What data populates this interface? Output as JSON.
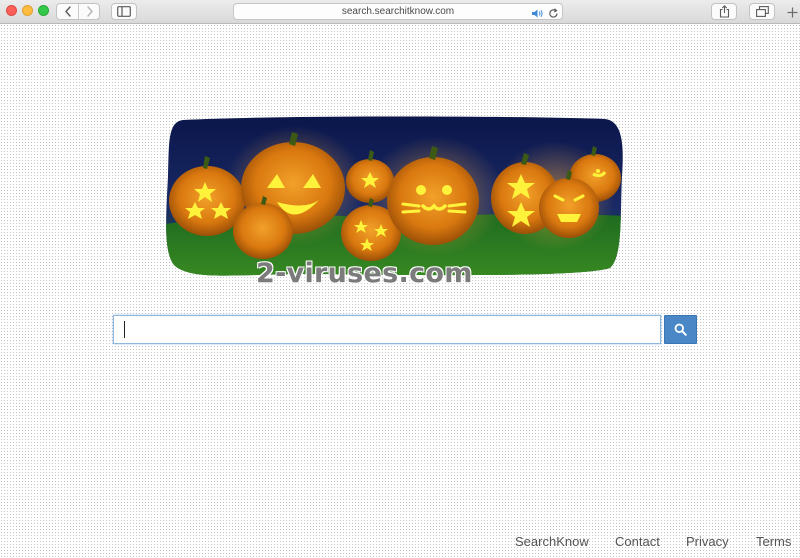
{
  "browser": {
    "url": "search.searchitknow.com"
  },
  "watermark": "2-viruses.com",
  "search": {
    "value": "",
    "placeholder": ""
  },
  "footer": {
    "links": [
      "SearchKnow",
      "Contact",
      "Privacy",
      "Terms"
    ]
  },
  "icons": {
    "window_controls": [
      "close-icon",
      "minimize-icon",
      "maximize-icon"
    ],
    "navigation": [
      "chevron-left-icon",
      "chevron-right-icon"
    ],
    "sidebar": "sidebar-icon",
    "address_bar": [
      "audio-icon",
      "reload-icon"
    ],
    "share": "share-icon",
    "tabs": "tabs-icon",
    "new_tab": "plus-icon",
    "search_button": "magnifier-icon"
  },
  "colors": {
    "search_button": "#4a87c6",
    "search_border": "#8fb8de",
    "footer_link": "#555555",
    "doodle_sky": "#0c1a52",
    "doodle_grass": "#1f6a1e",
    "pumpkin": "#d9780f",
    "carving_glow": "#fff23a"
  }
}
